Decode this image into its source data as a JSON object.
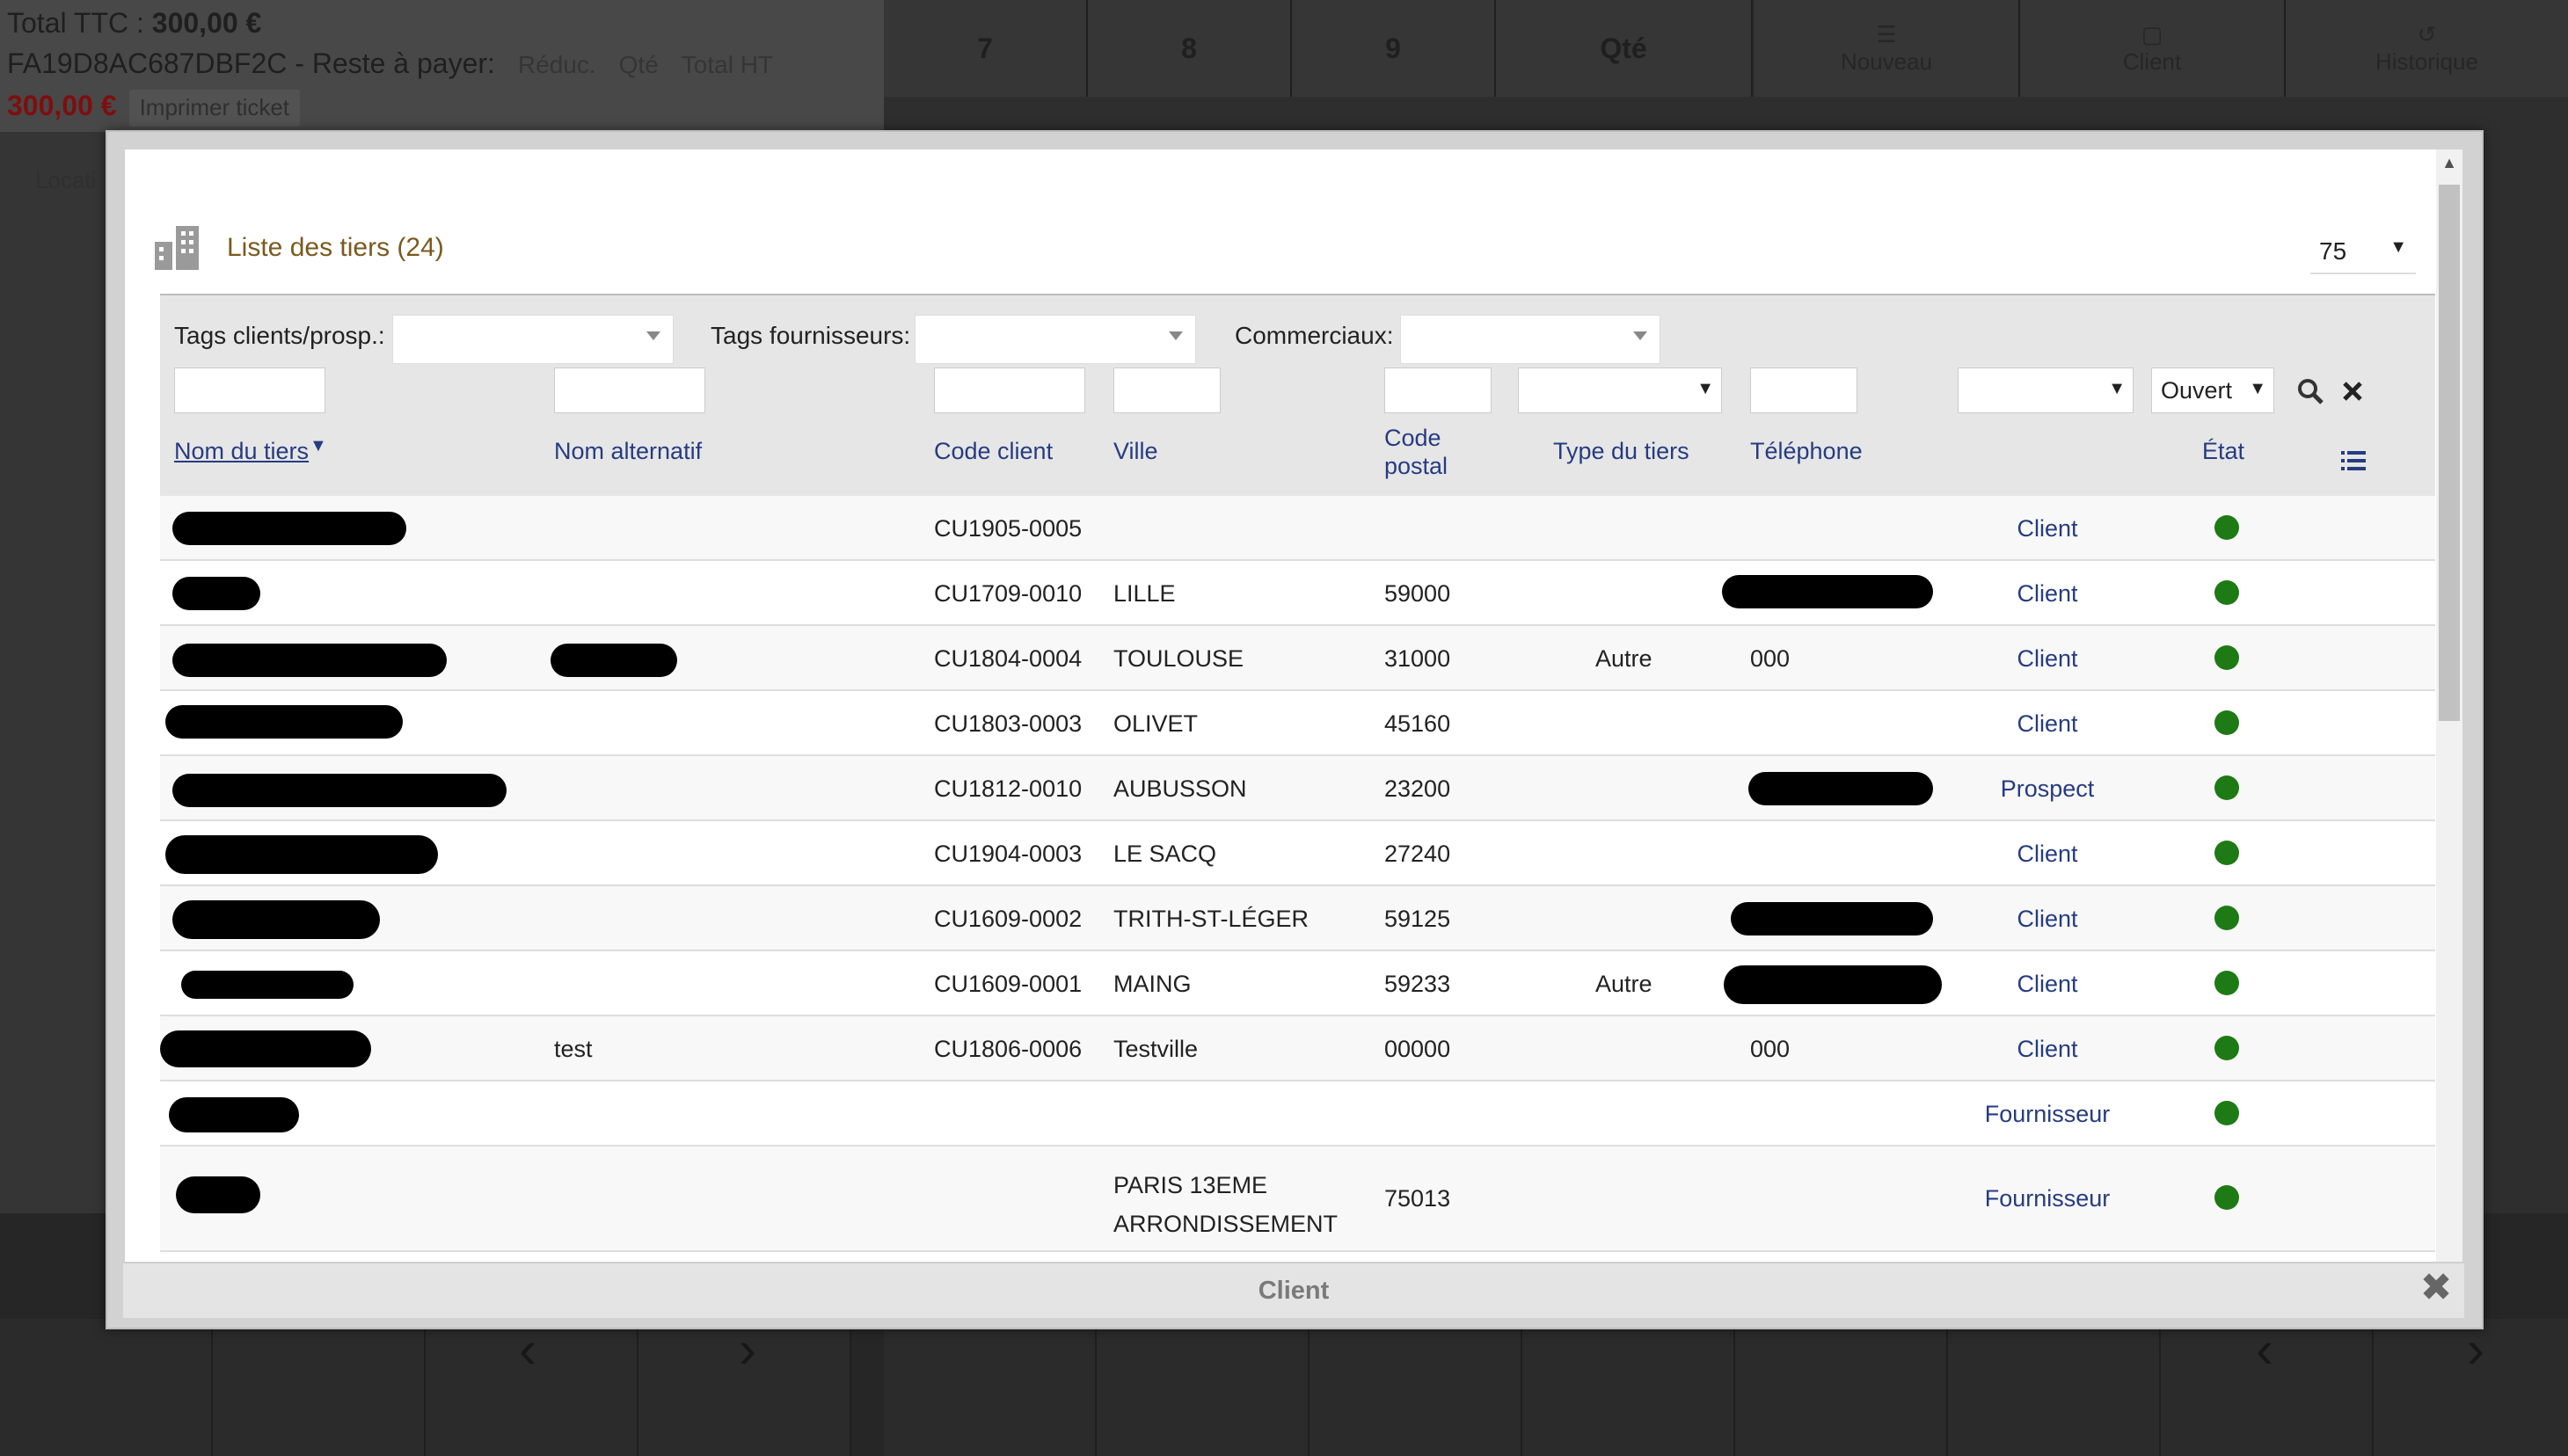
{
  "pos": {
    "total_label": "Total TTC :",
    "total_value": "300,00 €",
    "invoice_ref": "FA19D8AC687DBF2C - Reste à payer:",
    "col_reduc": "Réduc.",
    "col_qty": "Qté",
    "col_total_ht": "Total HT",
    "remaining": "300,00 €",
    "print_button": "Imprimer ticket",
    "location_partial": "Locati",
    "keypad": [
      "7",
      "8",
      "9",
      "Qté"
    ],
    "actions": [
      "Nouveau",
      "Client",
      "Historique"
    ]
  },
  "modal": {
    "footer_title": "Client",
    "list_title": "Liste des tiers (24)",
    "limit": "75",
    "filters": {
      "tags_clients_label": "Tags clients/prosp.:",
      "tags_fournisseurs_label": "Tags fournisseurs:",
      "commerciaux_label": "Commerciaux:",
      "status_value": "Ouvert"
    },
    "columns": {
      "name": "Nom du tiers",
      "alt_name": "Nom alternatif",
      "code": "Code client",
      "town": "Ville",
      "zip_1": "Code",
      "zip_2": "postal",
      "type": "Type du tiers",
      "phone": "Téléphone",
      "state": "État"
    },
    "rows": [
      {
        "alt": "",
        "code": "CU1905-0005",
        "town": "",
        "zip": "",
        "type": "",
        "phone": "",
        "nature": "Client"
      },
      {
        "alt": "",
        "code": "CU1709-0010",
        "town": "LILLE",
        "zip": "59000",
        "type": "",
        "phone": "",
        "nature": "Client"
      },
      {
        "alt": "",
        "code": "CU1804-0004",
        "town": "TOULOUSE",
        "zip": "31000",
        "type": "Autre",
        "phone": "000",
        "nature": "Client"
      },
      {
        "alt": "",
        "code": "CU1803-0003",
        "town": "OLIVET",
        "zip": "45160",
        "type": "",
        "phone": "",
        "nature": "Client"
      },
      {
        "alt": "",
        "code": "CU1812-0010",
        "town": "AUBUSSON",
        "zip": "23200",
        "type": "",
        "phone": "",
        "nature": "Prospect"
      },
      {
        "alt": "",
        "code": "CU1904-0003",
        "town": "LE SACQ",
        "zip": "27240",
        "type": "",
        "phone": "",
        "nature": "Client"
      },
      {
        "alt": "",
        "code": "CU1609-0002",
        "town": "TRITH-ST-LÉGER",
        "zip": "59125",
        "type": "",
        "phone": "",
        "nature": "Client"
      },
      {
        "alt": "",
        "code": "CU1609-0001",
        "town": "MAING",
        "zip": "59233",
        "type": "Autre",
        "phone": "",
        "nature": "Client"
      },
      {
        "alt": "test",
        "code": "CU1806-0006",
        "town": "Testville",
        "zip": "00000",
        "type": "",
        "phone": "000",
        "nature": "Client"
      },
      {
        "alt": "",
        "code": "",
        "town": "",
        "zip": "",
        "type": "",
        "phone": "",
        "nature": "Fournisseur"
      },
      {
        "alt": "",
        "code": "",
        "town_1": "PARIS 13EME",
        "town_2": "ARRONDISSEMENT",
        "zip": "75013",
        "type": "",
        "phone": "",
        "nature": "Fournisseur"
      }
    ],
    "status_color": "#1e7a14",
    "link_color": "#263c81",
    "title_color": "#7a5a1e"
  }
}
